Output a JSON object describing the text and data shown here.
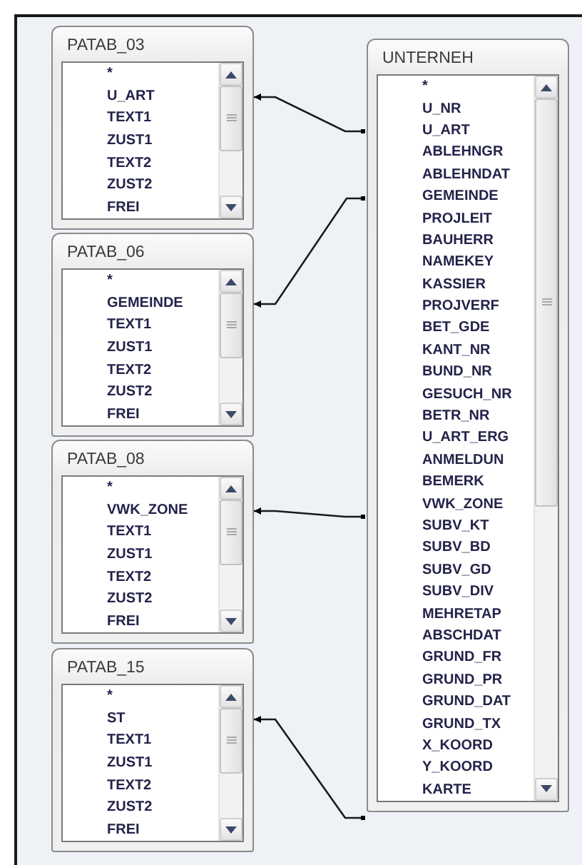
{
  "tables": [
    {
      "name": "PATAB_03",
      "fields": [
        "*",
        "U_ART",
        "TEXT1",
        "ZUST1",
        "TEXT2",
        "ZUST2",
        "FREI"
      ]
    },
    {
      "name": "PATAB_06",
      "fields": [
        "*",
        "GEMEINDE",
        "TEXT1",
        "ZUST1",
        "TEXT2",
        "ZUST2",
        "FREI"
      ]
    },
    {
      "name": "PATAB_08",
      "fields": [
        "*",
        "VWK_ZONE",
        "TEXT1",
        "ZUST1",
        "TEXT2",
        "ZUST2",
        "FREI"
      ]
    },
    {
      "name": "PATAB_15",
      "fields": [
        "*",
        "ST",
        "TEXT1",
        "ZUST1",
        "TEXT2",
        "ZUST2",
        "FREI"
      ]
    },
    {
      "name": "UNTERNEH",
      "fields": [
        "*",
        "U_NR",
        "U_ART",
        "ABLEHNGR",
        "ABLEHNDAT",
        "GEMEINDE",
        "PROJLEIT",
        "BAUHERR",
        "NAMEKEY",
        "KASSIER",
        "PROJVERF",
        "BET_GDE",
        "KANT_NR",
        "BUND_NR",
        "GESUCH_NR",
        "BETR_NR",
        "U_ART_ERG",
        "ANMELDUN",
        "BEMERK",
        "VWK_ZONE",
        "SUBV_KT",
        "SUBV_BD",
        "SUBV_GD",
        "SUBV_DIV",
        "MEHRETAP",
        "ABSCHDAT",
        "GRUND_FR",
        "GRUND_PR",
        "GRUND_DAT",
        "GRUND_TX",
        "X_KOORD",
        "Y_KOORD",
        "KARTE"
      ]
    }
  ]
}
